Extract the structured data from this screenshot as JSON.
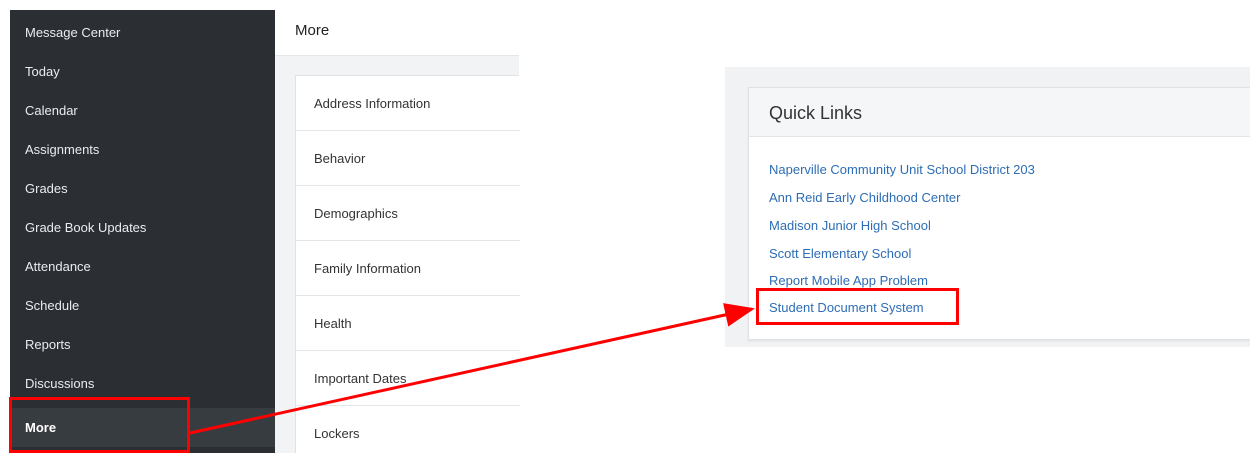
{
  "sidebar": {
    "items": [
      {
        "label": "Message Center"
      },
      {
        "label": "Today"
      },
      {
        "label": "Calendar"
      },
      {
        "label": "Assignments"
      },
      {
        "label": "Grades"
      },
      {
        "label": "Grade Book Updates"
      },
      {
        "label": "Attendance"
      },
      {
        "label": "Schedule"
      },
      {
        "label": "Reports"
      },
      {
        "label": "Discussions"
      },
      {
        "label": "More"
      }
    ],
    "active_item": "More"
  },
  "more": {
    "title": "More",
    "items": [
      {
        "label": "Address Information"
      },
      {
        "label": "Behavior"
      },
      {
        "label": "Demographics"
      },
      {
        "label": "Family Information"
      },
      {
        "label": "Health"
      },
      {
        "label": "Important Dates"
      },
      {
        "label": "Lockers"
      }
    ]
  },
  "quick_links": {
    "title": "Quick Links",
    "links": [
      {
        "label": "Naperville Community Unit School District 203"
      },
      {
        "label": "Ann Reid Early Childhood Center"
      },
      {
        "label": "Madison Junior High School"
      },
      {
        "label": "Scott Elementary School"
      },
      {
        "label": "Report Mobile App Problem"
      },
      {
        "label": "Student Document System"
      }
    ]
  },
  "colors": {
    "sidebar_bg": "#2b2f33",
    "link": "#2d6db5",
    "annotation": "#ff0000"
  }
}
